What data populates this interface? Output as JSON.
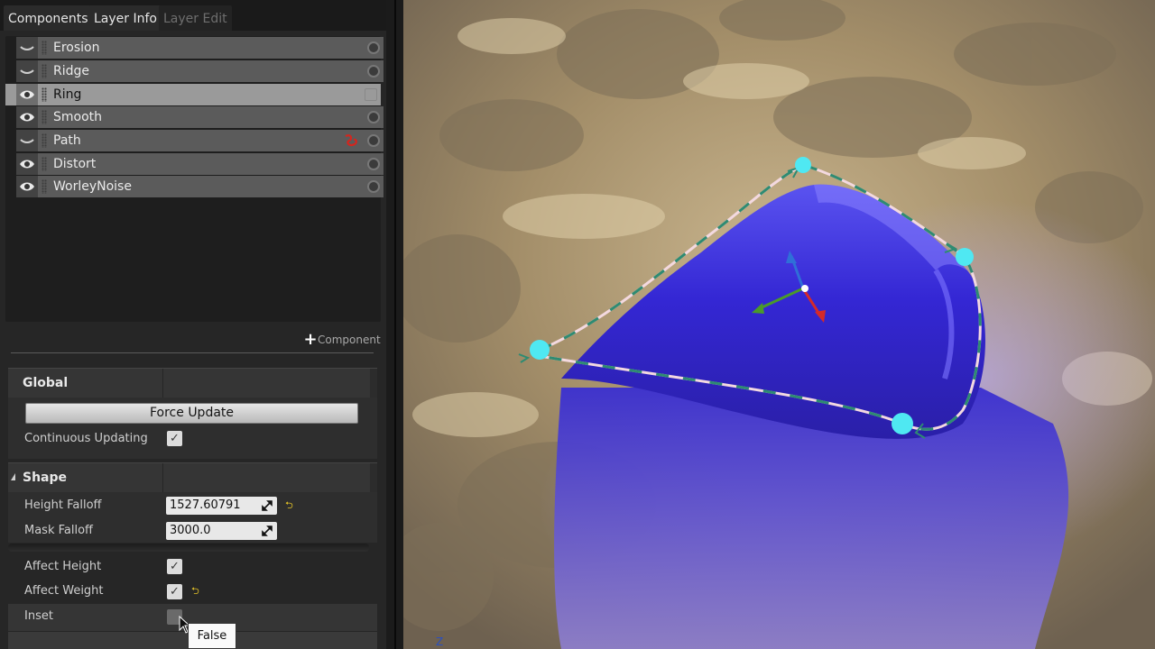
{
  "tabs": [
    "Components",
    "Layer Info",
    "Layer Edit"
  ],
  "components": [
    {
      "label": "Erosion",
      "visible": false,
      "selected": false,
      "spline": false
    },
    {
      "label": "Ridge",
      "visible": false,
      "selected": false,
      "spline": false
    },
    {
      "label": "Ring",
      "visible": true,
      "selected": true,
      "spline": false
    },
    {
      "label": "Smooth",
      "visible": true,
      "selected": false,
      "spline": false
    },
    {
      "label": "Path",
      "visible": false,
      "selected": false,
      "spline": true
    },
    {
      "label": "Distort",
      "visible": true,
      "selected": false,
      "spline": false
    },
    {
      "label": "WorleyNoise",
      "visible": true,
      "selected": false,
      "spline": false
    }
  ],
  "add_component_label": "Component",
  "global": {
    "title": "Global",
    "force_update_label": "Force Update",
    "continuous_updating_label": "Continuous Updating",
    "continuous_updating": true
  },
  "shape": {
    "title": "Shape",
    "height_falloff_label": "Height Falloff",
    "height_falloff_value": "1527.60791",
    "mask_falloff_label": "Mask Falloff",
    "mask_falloff_value": "3000.0",
    "affect_height_label": "Affect Height",
    "affect_height": true,
    "affect_weight_label": "Affect Weight",
    "affect_weight": true,
    "inset_label": "Inset",
    "inset": false
  },
  "tooltip": "False",
  "viewport": {
    "axis_label": "Z",
    "colors": {
      "sand": "#a48f6a",
      "blob": "#3b2fd0",
      "control_point": "#4fe8f2",
      "spline_dash": "#2e8b72"
    }
  }
}
